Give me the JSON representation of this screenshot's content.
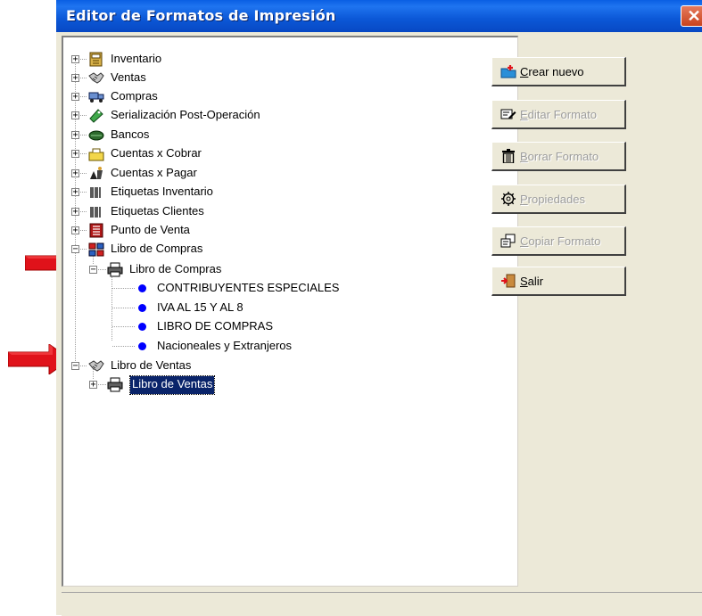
{
  "window": {
    "title": "Editor de Formatos de Impresión",
    "close_glyph": "✕"
  },
  "tree": {
    "root_items": [
      {
        "label": "Inventario",
        "icon": "inventory-icon",
        "expander": "+"
      },
      {
        "label": "Ventas",
        "icon": "handshake-icon",
        "expander": "+"
      },
      {
        "label": "Compras",
        "icon": "truck-icon",
        "expander": "+"
      },
      {
        "label": "Serialización Post-Operación",
        "icon": "tag-icon",
        "expander": "+"
      },
      {
        "label": "Bancos",
        "icon": "money-icon",
        "expander": "+"
      },
      {
        "label": "Cuentas x Cobrar",
        "icon": "cash-register-icon",
        "expander": "+"
      },
      {
        "label": "Cuentas x Pagar",
        "icon": "payment-icon",
        "expander": "+"
      },
      {
        "label": "Etiquetas Inventario",
        "icon": "barcode-icon",
        "expander": "+"
      },
      {
        "label": "Etiquetas Clientes",
        "icon": "barcode-icon",
        "expander": "+"
      },
      {
        "label": "Punto de Venta",
        "icon": "pos-icon",
        "expander": "+"
      },
      {
        "label": "Libro de Compras",
        "icon": "ledger-icon",
        "expander": "−"
      }
    ],
    "libro_compras_child": {
      "label": "Libro de Compras",
      "icon": "printer-icon",
      "expander": "−"
    },
    "libro_compras_formats": [
      "CONTRIBUYENTES ESPECIALES",
      "IVA AL 15 Y AL 8",
      "LIBRO DE COMPRAS",
      "Nacioneales y Extranjeros"
    ],
    "libro_ventas": {
      "label": "Libro de Ventas",
      "icon": "handshake-icon",
      "expander": "−"
    },
    "libro_ventas_child": {
      "label": "Libro de Ventas",
      "icon": "printer-icon",
      "expander": "+",
      "selected": true
    }
  },
  "buttons": {
    "crear": {
      "mnemonic": "C",
      "rest": "rear nuevo",
      "enabled": true,
      "icon": "new-folder-icon"
    },
    "editar": {
      "mnemonic": "E",
      "rest": "ditar Formato",
      "enabled": false,
      "icon": "edit-icon"
    },
    "borrar": {
      "mnemonic": "B",
      "rest": "orrar Formato",
      "enabled": false,
      "icon": "trash-icon"
    },
    "propiedades": {
      "mnemonic": "P",
      "rest": "ropiedades",
      "enabled": false,
      "icon": "gear-icon"
    },
    "copiar": {
      "mnemonic": "C",
      "rest": "opiar Formato",
      "enabled": false,
      "icon": "copy-icon"
    },
    "salir": {
      "mnemonic": "S",
      "rest": "alir",
      "enabled": true,
      "icon": "exit-door-icon"
    }
  },
  "colors": {
    "titlebar": "#0b57d6",
    "selection": "#0a246a",
    "bullet": "#0000ff",
    "annotation_arrow": "#e0121a"
  }
}
